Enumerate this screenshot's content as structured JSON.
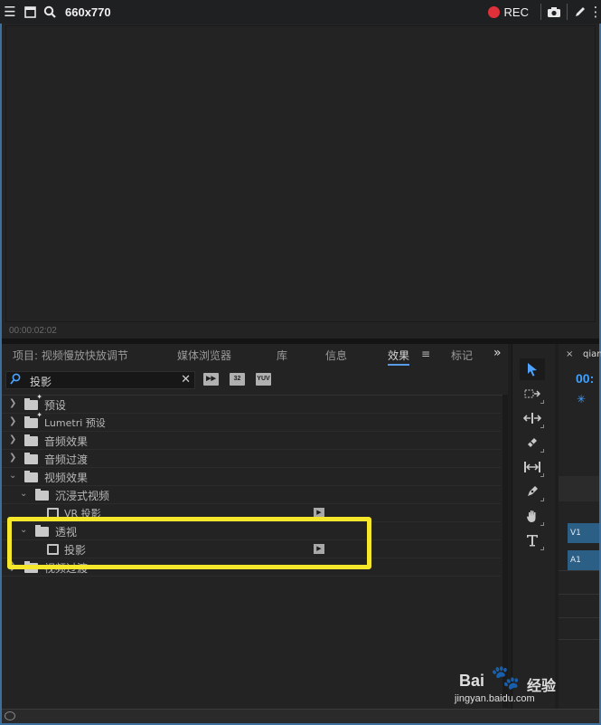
{
  "toolbar": {
    "menu_icon": "hamburger-icon",
    "window_icon": "window-icon",
    "zoom_icon": "magnifier-icon",
    "size_label": "660x770",
    "rec_label": "REC",
    "rec_color": "#e0303a",
    "camera_icon": "camera-icon",
    "pen_icon": "pen-icon"
  },
  "monitor": {
    "timecode": "00:00:02:02"
  },
  "panel": {
    "tabs": [
      {
        "label": "项目: 视频慢放快放调节",
        "active": false
      },
      {
        "label": "媒体浏览器",
        "active": false
      },
      {
        "label": "库",
        "active": false
      },
      {
        "label": "信息",
        "active": false
      },
      {
        "label": "效果",
        "active": true
      },
      {
        "label": "标记",
        "active": false
      }
    ],
    "tab_menu_glyph": "≡",
    "overflow_glyph": "»",
    "search": {
      "query": "投影",
      "clear_glyph": "✕"
    },
    "filter_badges": [
      "▶▶",
      "32",
      "YUV"
    ],
    "tree": [
      {
        "label": "预设",
        "expanded": false,
        "kind": "preset-folder",
        "level": 0
      },
      {
        "label": "Lumetri 预设",
        "expanded": false,
        "kind": "preset-folder",
        "level": 0
      },
      {
        "label": "音频效果",
        "expanded": false,
        "kind": "folder",
        "level": 0
      },
      {
        "label": "音频过渡",
        "expanded": false,
        "kind": "folder",
        "level": 0
      },
      {
        "label": "视频效果",
        "expanded": true,
        "kind": "folder",
        "level": 0
      },
      {
        "label": "沉浸式视频",
        "expanded": true,
        "kind": "folder",
        "level": 1
      },
      {
        "label": "VR 投影",
        "kind": "effect",
        "level": 2,
        "accelerated": true
      },
      {
        "label": "透视",
        "expanded": true,
        "kind": "folder",
        "level": 1
      },
      {
        "label": "投影",
        "kind": "effect",
        "level": 2,
        "accelerated": true
      },
      {
        "label": "视频过渡",
        "expanded": false,
        "kind": "folder",
        "level": 0
      }
    ],
    "highlight_color": "#f5e82a"
  },
  "tools": [
    {
      "name": "selection-tool-icon",
      "glyph": "➤",
      "active": true
    },
    {
      "name": "track-select-tool-icon",
      "glyph": "⇥",
      "active": false
    },
    {
      "name": "ripple-edit-tool-icon",
      "glyph": "⟺",
      "active": false
    },
    {
      "name": "razor-tool-icon",
      "glyph": "◆",
      "active": false
    },
    {
      "name": "slip-tool-icon",
      "glyph": "↔",
      "active": false
    },
    {
      "name": "pen-tool-icon",
      "glyph": "✒",
      "active": false
    },
    {
      "name": "hand-tool-icon",
      "glyph": "✋",
      "active": false
    },
    {
      "name": "type-tool-icon",
      "glyph": "T",
      "active": false
    }
  ],
  "timeline": {
    "close_glyph": "×",
    "sequence_name": "qian",
    "time": "00:",
    "snap_glyph": "✳",
    "tracks": [
      "V1",
      "A1"
    ]
  },
  "watermark": {
    "word": "Bai",
    "paw": "🐾",
    "jy": "经验",
    "url": "jingyan.baidu.com"
  }
}
